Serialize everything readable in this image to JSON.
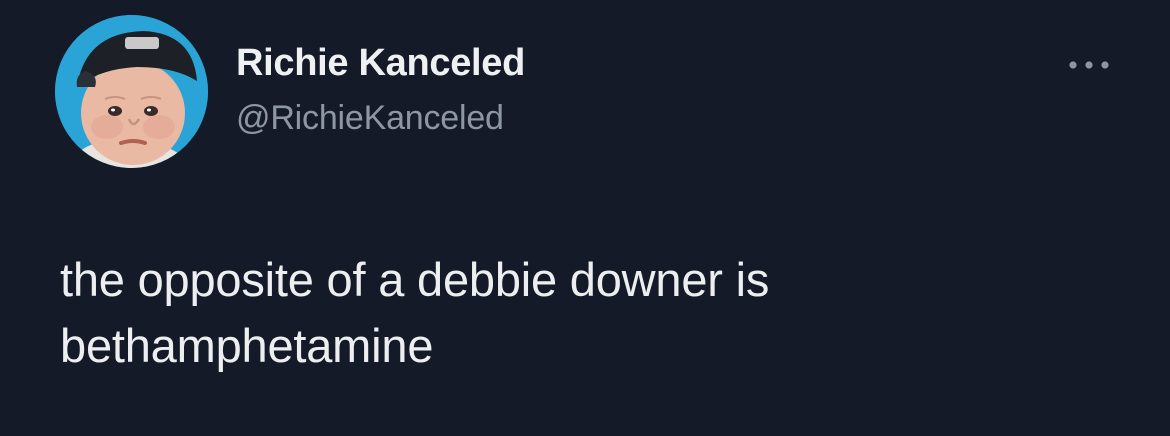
{
  "tweet": {
    "author": {
      "display_name": "Richie Kanceled",
      "handle": "@RichieKanceled",
      "avatar_icon": "baby-face-avatar"
    },
    "more_icon": "more-horizontal-icon",
    "text_lines": [
      "the opposite of a debbie downer is",
      "bethamphetamine"
    ]
  },
  "colors": {
    "background": "#151a28",
    "text": "#e7e9ea",
    "secondary_text": "#8d97a4",
    "avatar_ring": "#2aa4d6"
  }
}
